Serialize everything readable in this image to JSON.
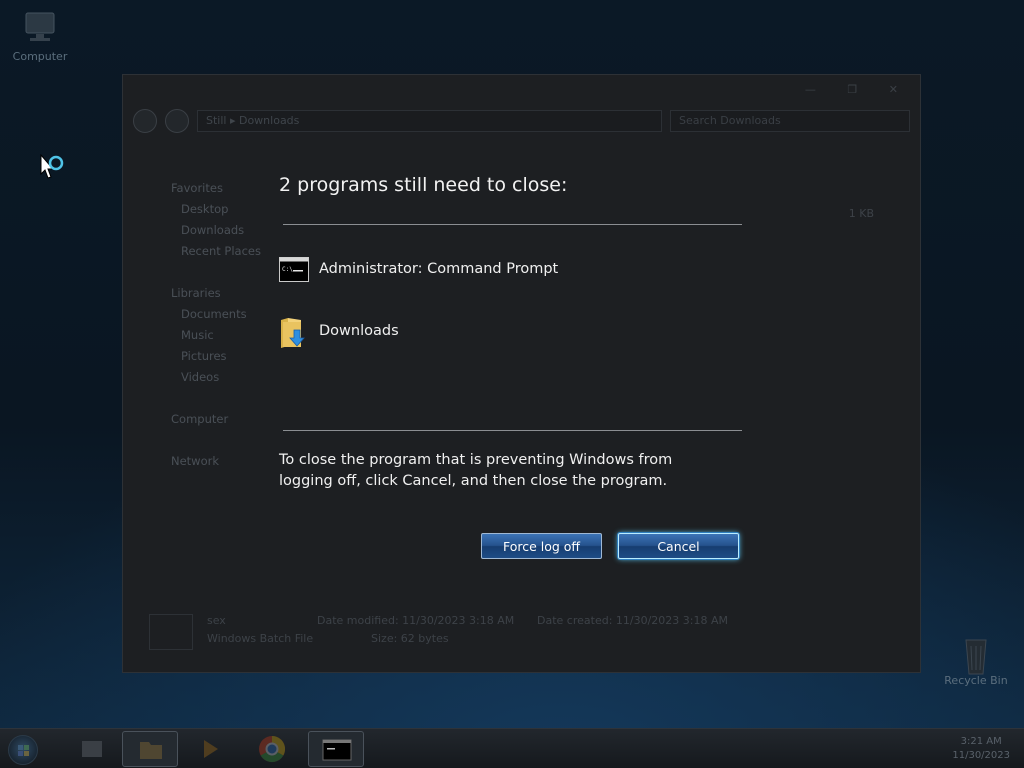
{
  "desktop": {
    "icons": [
      {
        "label": "Computer"
      },
      {
        "label": "Recycle Bin"
      }
    ]
  },
  "explorer": {
    "path": [
      "Still",
      "Downloads"
    ],
    "search_placeholder": "Search Downloads",
    "nav": {
      "favorites": {
        "label": "Favorites",
        "items": [
          "Desktop",
          "Downloads",
          "Recent Places"
        ]
      },
      "libraries": {
        "label": "Libraries",
        "items": [
          "Documents",
          "Music",
          "Pictures",
          "Videos"
        ]
      },
      "computer": "Computer",
      "network": "Network"
    },
    "file_size_hint": "1 KB",
    "status": {
      "name": "sex",
      "type": "Windows Batch File",
      "date_modified": "Date modified: 11/30/2023 3:18 AM",
      "date_created": "Date created: 11/30/2023 3:18 AM",
      "size": "Size: 62 bytes"
    }
  },
  "dialog": {
    "heading": "2 programs still need to close:",
    "programs": [
      {
        "name": "Administrator:  Command Prompt",
        "icon": "command-prompt-icon"
      },
      {
        "name": "Downloads",
        "icon": "folder-download-icon"
      }
    ],
    "message": "To close the program that is preventing Windows from logging off, click Cancel, and then close the program.",
    "buttons": {
      "force": "Force log off",
      "cancel": "Cancel"
    }
  },
  "taskbar": {
    "items": [
      "start-orb",
      "file-explorer-icon",
      "explorer-folder-icon",
      "media-player-icon",
      "chrome-icon",
      "command-prompt-icon"
    ],
    "clock": {
      "time": "3:21 AM",
      "date": "11/30/2023"
    }
  },
  "colors": {
    "accent": "#2f5f9f",
    "default_glow": "#5fd0ff",
    "text": "#f0f0f0"
  }
}
